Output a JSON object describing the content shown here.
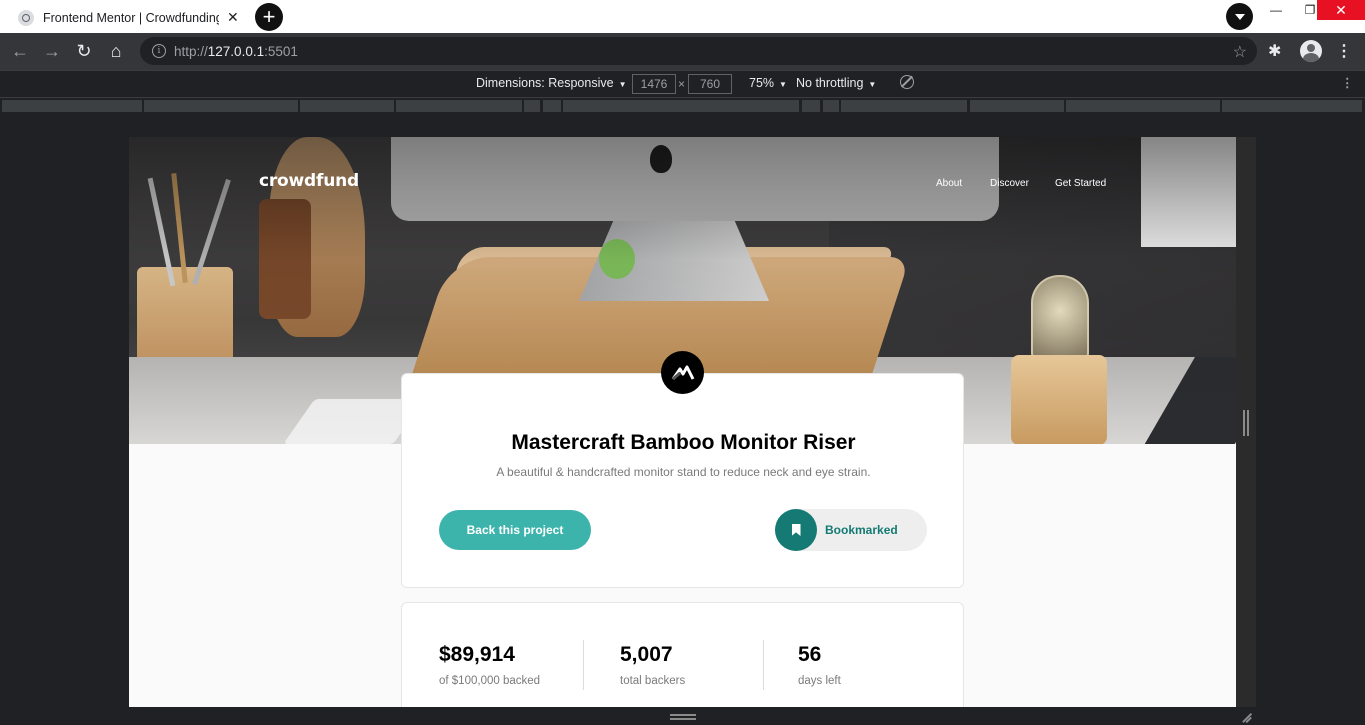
{
  "browser": {
    "tab_title": "Frontend Mentor | Crowdfunding",
    "url_scheme": "http://",
    "url_host": "127.0.0.1",
    "url_port": ":5501"
  },
  "devtools": {
    "dimensions_label": "Dimensions: Responsive",
    "width": "1476",
    "height": "760",
    "times": "×",
    "zoom": "75%",
    "throttling": "No throttling"
  },
  "site": {
    "logo": "crowdfund",
    "nav": [
      "About",
      "Discover",
      "Get Started"
    ]
  },
  "project": {
    "title": "Mastercraft Bamboo Monitor Riser",
    "description": "A beautiful & handcrafted monitor stand to reduce neck and eye strain.",
    "back_label": "Back this project",
    "bookmark_label": "Bookmarked"
  },
  "stats": [
    {
      "value": "$89,914",
      "label": "of $100,000 backed"
    },
    {
      "value": "5,007",
      "label": "total backers"
    },
    {
      "value": "56",
      "label": "days left"
    }
  ],
  "colors": {
    "accent": "#3cb4ac",
    "accent_dark": "#147a73"
  }
}
